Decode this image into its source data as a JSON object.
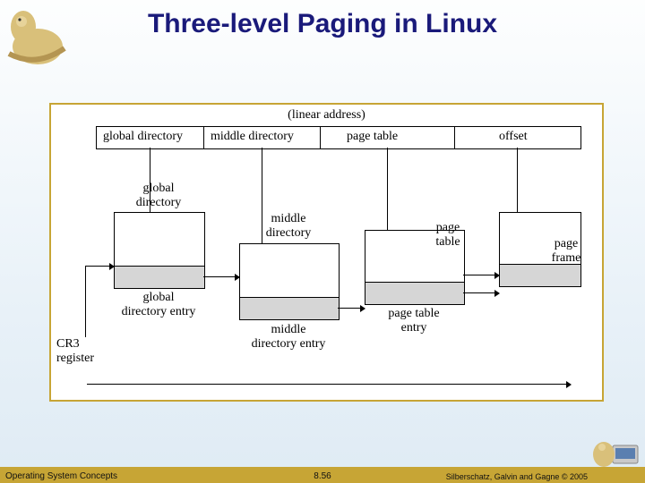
{
  "title": "Three-level Paging in Linux",
  "footer": {
    "left": "Operating System Concepts",
    "center": "8.56",
    "right": "Silberschatz, Galvin and Gagne © 2005"
  },
  "diagram": {
    "linear_address_caption": "(linear address)",
    "fields": {
      "global": "global directory",
      "middle": "middle directory",
      "page_table": "page table",
      "offset": "offset"
    },
    "boxes": {
      "global_directory": "global\ndirectory",
      "global_directory_entry": "global\ndirectory entry",
      "middle_directory": "middle\ndirectory",
      "middle_directory_entry": "middle\ndirectory entry",
      "page_table": "page\ntable",
      "page_table_entry": "page table\nentry",
      "page_frame": "page\nframe"
    },
    "cr3": "CR3\nregister"
  },
  "icons": {
    "logo_tl": "dinosaur-book-logo",
    "logo_br": "dinosaur-computer-logo"
  }
}
